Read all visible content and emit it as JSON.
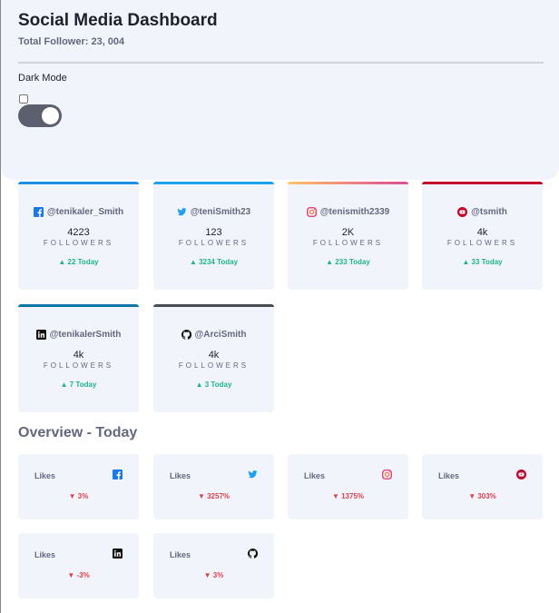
{
  "header": {
    "title": "Social Media Dashboard",
    "subtitle": "Total Follower: 23, 004",
    "dark_mode_label": "Dark Mode"
  },
  "cards": [
    {
      "platform": "facebook",
      "handle": "@tenikaler_Smith",
      "count": "4223",
      "label": "FOLLOWERS",
      "today": "▲ 22 Today",
      "color": "#1877f2"
    },
    {
      "platform": "twitter",
      "handle": "@teniSmith23",
      "count": "123",
      "label": "FOLLOWERS",
      "today": "▲ 3234 Today",
      "color": "#1da1f2"
    },
    {
      "platform": "instagram",
      "handle": "@tenismith2339",
      "count": "2K",
      "label": "FOLLOWERS",
      "today": "▲ 233 Today",
      "color": "#e1306c"
    },
    {
      "platform": "youtube",
      "handle": "@tsmith",
      "count": "4k",
      "label": "FOLLOWERS",
      "today": "▲ 33 Today",
      "color": "#c4032b"
    },
    {
      "platform": "linkedin",
      "handle": "@tenikalerSmith",
      "count": "4k",
      "label": "FOLLOWERS",
      "today": "▲ 7 Today",
      "color": "#0a66c2"
    },
    {
      "platform": "github",
      "handle": "@ArciSmith",
      "count": "4k",
      "label": "FOLLOWERS",
      "today": "▲ 3 Today",
      "color": "#4a4a52"
    }
  ],
  "overview": {
    "title": "Overview - Today",
    "items": [
      {
        "platform": "facebook",
        "label": "Likes",
        "change": "▼ 3%"
      },
      {
        "platform": "twitter",
        "label": "Likes",
        "change": "▼ 3257%"
      },
      {
        "platform": "instagram",
        "label": "Likes",
        "change": "▼ 1375%"
      },
      {
        "platform": "youtube",
        "label": "Likes",
        "change": "▼ 303%"
      },
      {
        "platform": "linkedin",
        "label": "Likes",
        "change": "▼ -3%"
      },
      {
        "platform": "github",
        "label": "Likes",
        "change": "▼ 3%"
      }
    ]
  }
}
